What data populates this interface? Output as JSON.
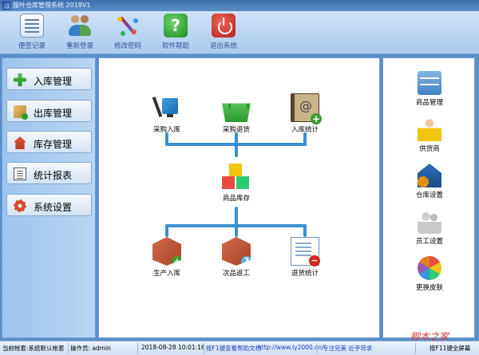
{
  "window": {
    "title": "服叶仓库管理系统 2018V1"
  },
  "toolbar": {
    "buttons": [
      {
        "label": "便签记录",
        "icon": "notepad-icon"
      },
      {
        "label": "重新登录",
        "icon": "users-icon"
      },
      {
        "label": "修改密码",
        "icon": "magic-wand-icon"
      },
      {
        "label": "软件帮助",
        "icon": "help-icon"
      },
      {
        "label": "退出系统",
        "icon": "power-icon"
      }
    ]
  },
  "sidebar": {
    "items": [
      {
        "label": "入库管理",
        "icon": "plus-icon"
      },
      {
        "label": "出库管理",
        "icon": "outbound-icon"
      },
      {
        "label": "库存管理",
        "icon": "house-icon"
      },
      {
        "label": "统计报表",
        "icon": "report-icon"
      },
      {
        "label": "系统设置",
        "icon": "gear-icon"
      }
    ]
  },
  "flow": {
    "top": [
      {
        "label": "采购入库",
        "icon": "hand-truck-icon"
      },
      {
        "label": "采购退货",
        "icon": "basket-icon"
      },
      {
        "label": "入库统计",
        "icon": "address-book-icon"
      }
    ],
    "center": {
      "label": "商品库存",
      "icon": "cubes-icon"
    },
    "bottom": [
      {
        "label": "生产入库",
        "icon": "box-add-icon"
      },
      {
        "label": "次品返工",
        "icon": "box-info-icon"
      },
      {
        "label": "退货统计",
        "icon": "document-remove-icon"
      }
    ],
    "connector_color": "#3a8fd1"
  },
  "rightbar": {
    "items": [
      {
        "label": "商品管理",
        "icon": "cabinet-icon"
      },
      {
        "label": "供货商",
        "icon": "supplier-icon"
      },
      {
        "label": "仓库设置",
        "icon": "warehouse-icon"
      },
      {
        "label": "员工设置",
        "icon": "staff-icon"
      },
      {
        "label": "更换皮肤",
        "icon": "color-wheel-icon"
      }
    ]
  },
  "statusbar": {
    "account": "当前帐套:系统默认帐套",
    "operator": "操作员: admin",
    "datetime": "2018-08-28 10:01:16",
    "help": "按F1键查看帮助文档",
    "url": "http://www.ly2000.cn/",
    "slogan": "专注完美 近乎苛求",
    "fullscreen": "按F11键全屏幕"
  },
  "watermark": "脚本之家"
}
